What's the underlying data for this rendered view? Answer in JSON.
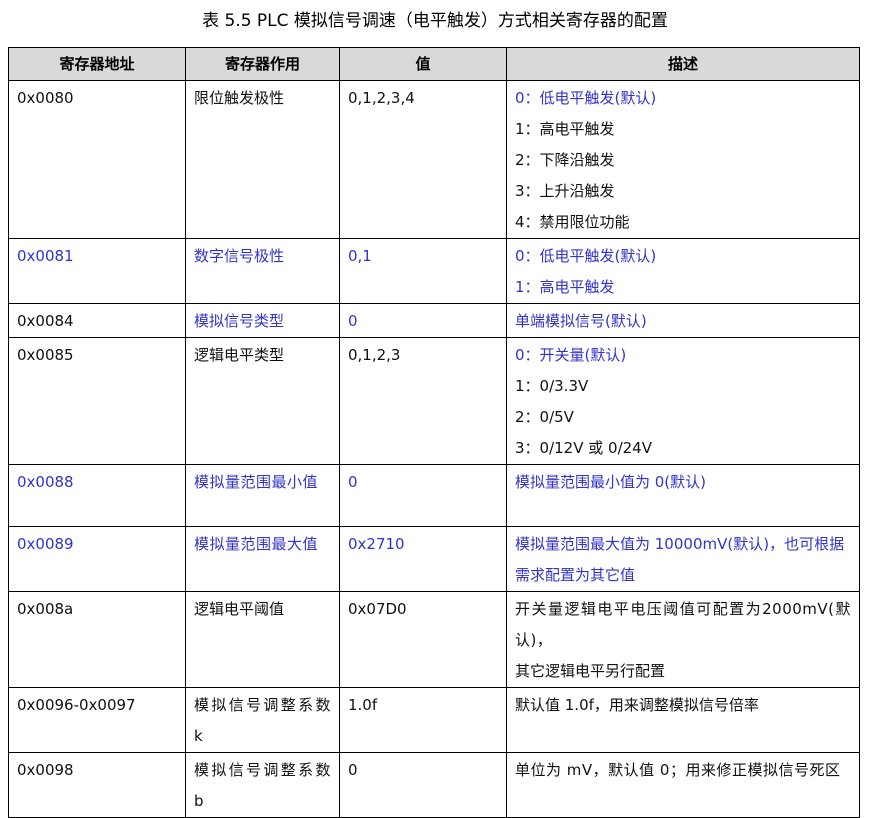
{
  "caption": "表 5.5 PLC 模拟信号调速（电平触发）方式相关寄存器的配置",
  "headers": [
    "寄存器地址",
    "寄存器作用",
    "值",
    "描述"
  ],
  "colors": {
    "highlight": "#3333cc",
    "header_bg": "#d9d9d9",
    "text": "#111111"
  },
  "rows": [
    {
      "address": "0x0080",
      "function": "限位触发极性",
      "value": "0,1,2,3,4",
      "desc": [
        "0：低电平触发(默认)",
        "1：高电平触发",
        "2：下降沿触发",
        "3：上升沿触发",
        "4：禁用限位功能"
      ]
    },
    {
      "address": "0x0081",
      "function": "数字信号极性",
      "value": "0,1",
      "desc": [
        "0：低电平触发(默认)",
        "1：高电平触发"
      ]
    },
    {
      "address": "0x0084",
      "function": "模拟信号类型",
      "value": "0",
      "desc": [
        "单端模拟信号(默认)"
      ]
    },
    {
      "address": "0x0085",
      "function": "逻辑电平类型",
      "value": "0,1,2,3",
      "desc": [
        "0：开关量(默认)",
        "1：0/3.3V",
        "2：0/5V",
        "3：0/12V 或 0/24V"
      ]
    },
    {
      "address": "0x0088",
      "function": "模拟量范围最小值",
      "value": "0",
      "desc": [
        "模拟量范围最小值为 0(默认)"
      ]
    },
    {
      "address": "0x0089",
      "function": "模拟量范围最大值",
      "value": "0x2710",
      "desc": [
        "模拟量范围最大值为 10000mV(默认)，也可根据需求配置为其它值"
      ]
    },
    {
      "address": "0x008a",
      "function": "逻辑电平阈值",
      "value": "0x07D0",
      "desc": [
        "开关量逻辑电平电压阈值可配置为2000mV(默认)，",
        "其它逻辑电平另行配置"
      ]
    },
    {
      "address": "0x0096-0x0097",
      "function": "模拟信号调整系数 k",
      "value": "1.0f",
      "desc": [
        "默认值 1.0f，用来调整模拟信号倍率"
      ]
    },
    {
      "address": "0x0098",
      "function": "模拟信号调整系数 b",
      "value": "0",
      "desc": [
        "单位为 mV，默认值 0；用来修正模拟信号死区"
      ]
    }
  ]
}
